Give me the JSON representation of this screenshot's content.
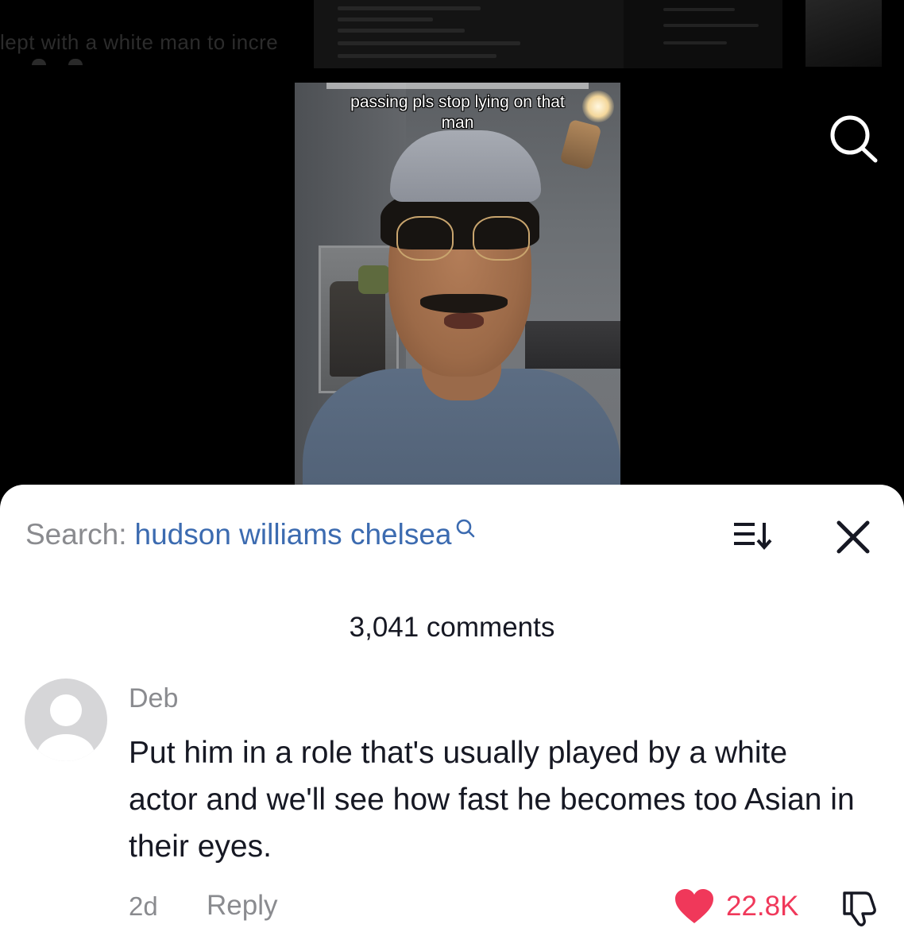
{
  "background": {
    "caption": "lept with a white man to incre"
  },
  "video": {
    "caption_line1": "passing pls stop lying on that",
    "caption_line2": "man"
  },
  "top_search_icon": "search-icon",
  "comments_sheet": {
    "search_prefix": "Search:",
    "search_term": "hudson williams chelsea",
    "search_term_icon": "search-icon",
    "sort_icon": "sort-icon",
    "close_icon": "close-icon",
    "count_label": "3,041 comments"
  },
  "comment": {
    "author": "Deb",
    "avatar_icon": "default-avatar-icon",
    "text": "Put him in a role that's usually played by a white actor and we'll see how fast he becomes too Asian in their eyes.",
    "time": "2d",
    "reply_label": "Reply",
    "like_icon": "heart-icon",
    "likes": "22.8K",
    "dislike_icon": "thumbs-down-icon"
  },
  "colors": {
    "link_blue": "#3c6bb0",
    "like_red": "#f0385a",
    "muted_gray": "#8a8b8f",
    "text_dark": "#161823"
  }
}
